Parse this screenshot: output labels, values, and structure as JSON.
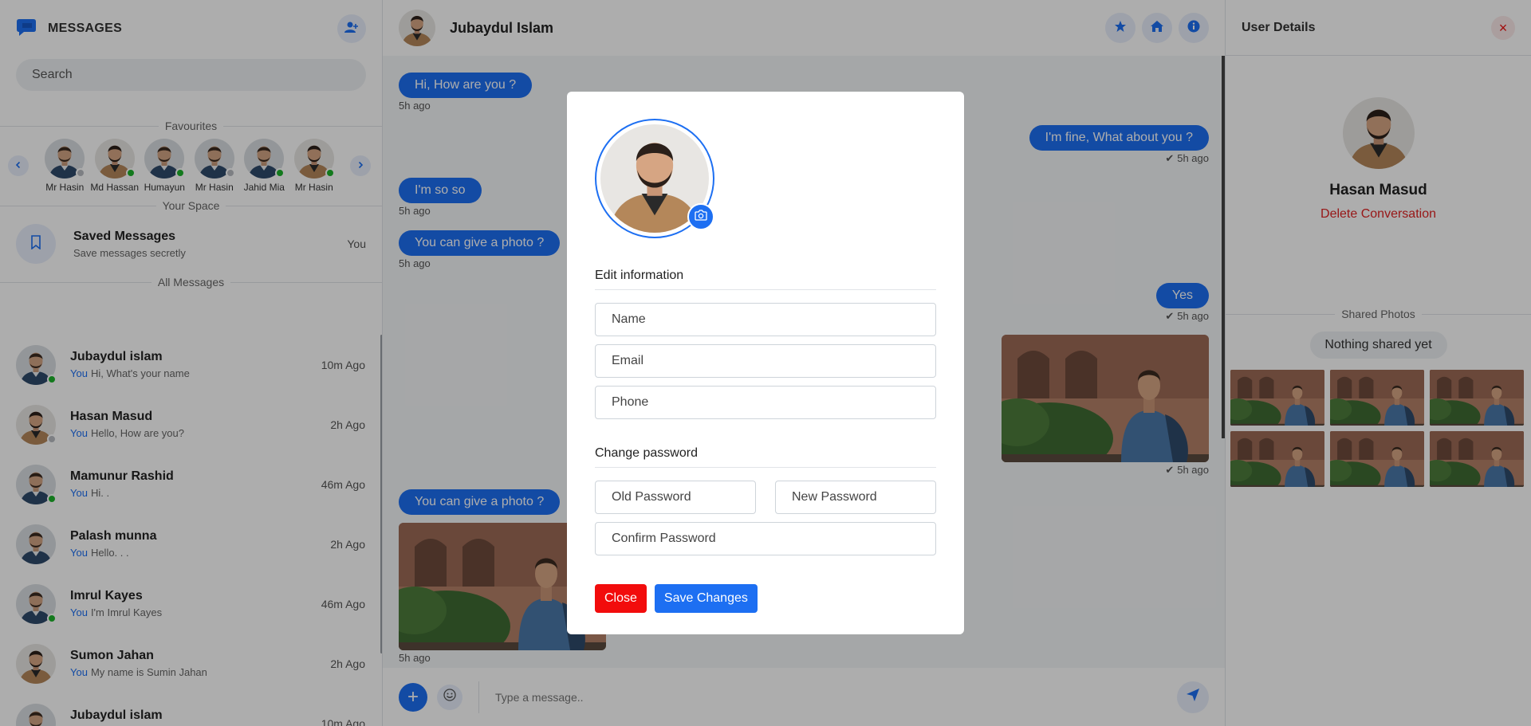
{
  "sidebar": {
    "title": "MESSAGES",
    "search_placeholder": "Search",
    "favourites_label": "Favourites",
    "favourites": [
      {
        "name": "Mr Hasin",
        "status": "offline"
      },
      {
        "name": "Md Hassan",
        "status": "online"
      },
      {
        "name": "Humayun",
        "status": "online"
      },
      {
        "name": "Mr Hasin",
        "status": "offline"
      },
      {
        "name": "Jahid Mia",
        "status": "online"
      },
      {
        "name": "Mr Hasin",
        "status": "online"
      }
    ],
    "your_space_label": "Your Space",
    "saved": {
      "title": "Saved Messages",
      "subtitle": "Save messages secretly",
      "right": "You"
    },
    "all_messages_label": "All Messages",
    "messages": [
      {
        "name": "Jubaydul islam",
        "you": "You",
        "preview": "Hi, What's your name",
        "time": "10m Ago",
        "status": "online"
      },
      {
        "name": "Hasan Masud",
        "you": "You",
        "preview": "Hello, How are you?",
        "time": "2h Ago",
        "status": "offline"
      },
      {
        "name": "Mamunur Rashid",
        "you": "You",
        "preview": "Hi. .",
        "time": "46m Ago",
        "status": "online"
      },
      {
        "name": "Palash munna",
        "you": "You",
        "preview": "Hello. . .",
        "time": "2h Ago",
        "status": "none"
      },
      {
        "name": "Imrul Kayes",
        "you": "You",
        "preview": "I'm Imrul Kayes",
        "time": "46m Ago",
        "status": "online"
      },
      {
        "name": "Sumon Jahan",
        "you": "You",
        "preview": "My name is Sumin Jahan",
        "time": "2h Ago",
        "status": "none"
      },
      {
        "name": "Jubaydul islam",
        "you": "",
        "preview": "",
        "time": "10m Ago",
        "status": "none"
      }
    ]
  },
  "chat": {
    "contact_name": "Jubaydul Islam",
    "messages": [
      {
        "text": "Hi, How are you ?",
        "time": "5h ago"
      },
      {
        "text": "I'm fine, What about you ?",
        "time": "5h ago"
      },
      {
        "text": "I'm so so",
        "time": "5h ago"
      },
      {
        "text": "You can give a photo ?",
        "time": "5h ago"
      },
      {
        "text": "Yes",
        "time": "5h ago"
      },
      {
        "text": "",
        "time": "5h ago"
      },
      {
        "text": "You can give a photo ?",
        "time": ""
      },
      {
        "text": "",
        "time": "5h ago"
      }
    ],
    "composer_placeholder": "Type a message.."
  },
  "details": {
    "title": "User Details",
    "name": "Hasan Masud",
    "delete_label": "Delete Conversation",
    "shared_label": "Shared Photos",
    "nothing_shared": "Nothing shared yet"
  },
  "modal": {
    "edit_label": "Edit information",
    "name_placeholder": "Name",
    "email_placeholder": "Email",
    "phone_placeholder": "Phone",
    "password_label": "Change password",
    "old_password_placeholder": "Old Password",
    "new_password_placeholder": "New Password",
    "confirm_password_placeholder": "Confirm Password",
    "close_label": "Close",
    "save_label": "Save Changes"
  },
  "colors": {
    "accent": "#1d6ff2",
    "danger": "#f20c0c",
    "online": "#1db32c"
  }
}
